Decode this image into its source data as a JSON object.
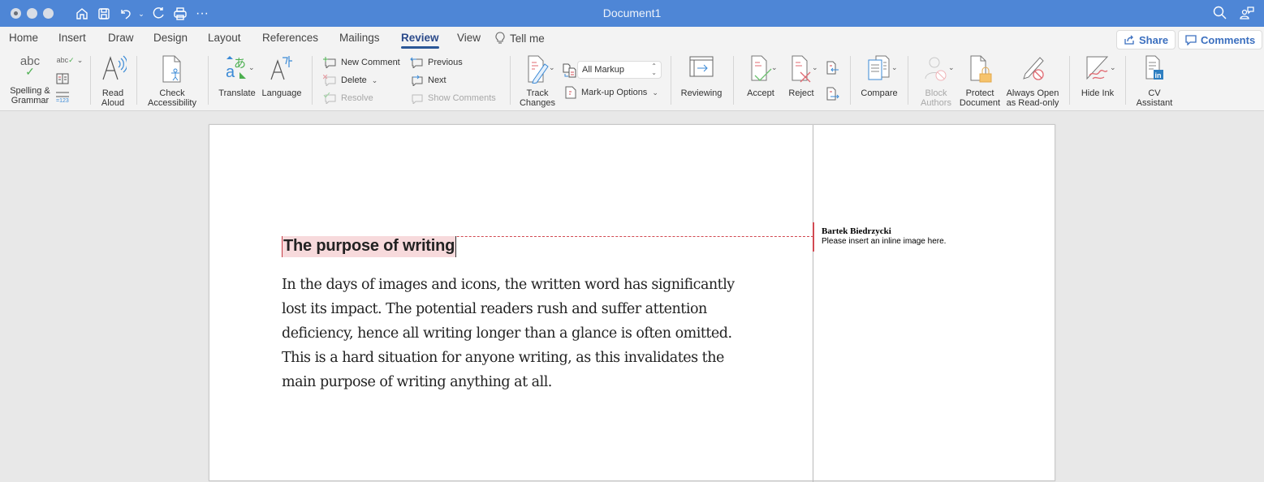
{
  "window": {
    "title": "Document1",
    "quick_access": [
      "home-icon",
      "save-icon",
      "undo-icon",
      "redo-icon",
      "print-icon",
      "more-icon"
    ]
  },
  "tabs": [
    {
      "label": "Home",
      "active": false
    },
    {
      "label": "Insert",
      "active": false
    },
    {
      "label": "Draw",
      "active": false
    },
    {
      "label": "Design",
      "active": false
    },
    {
      "label": "Layout",
      "active": false
    },
    {
      "label": "References",
      "active": false
    },
    {
      "label": "Mailings",
      "active": false
    },
    {
      "label": "Review",
      "active": true
    },
    {
      "label": "View",
      "active": false
    }
  ],
  "tell_me": "Tell me",
  "top_buttons": {
    "share": "Share",
    "comments": "Comments"
  },
  "ribbon": {
    "spelling": "Spelling &\nGrammar",
    "read_aloud": "Read\nAloud",
    "check_accessibility": "Check\nAccessibility",
    "translate": "Translate",
    "language": "Language",
    "new_comment": "New Comment",
    "delete": "Delete",
    "resolve": "Resolve",
    "previous": "Previous",
    "next": "Next",
    "show_comments": "Show Comments",
    "track_changes": "Track\nChanges",
    "markup_select": "All Markup",
    "markup_options": "Mark-up Options",
    "reviewing": "Reviewing",
    "accept": "Accept",
    "reject": "Reject",
    "compare": "Compare",
    "block_authors": "Block\nAuthors",
    "protect_document": "Protect\nDocument",
    "always_open_readonly": "Always Open\nas Read-only",
    "hide_ink": "Hide Ink",
    "cv_assistant": "CV\nAssistant"
  },
  "document": {
    "heading": "The purpose of writing",
    "body": "In the days of images and icons, the written word has significantly lost its impact. The potential readers rush and suffer attention deficiency, hence all writing longer than a glance is often omitted. This is a hard situation for anyone writing, as this invalidates the main purpose of writing anything at all.",
    "comment": {
      "author": "Bartek Biedrzycki",
      "text": "Please insert an inline image here."
    }
  },
  "colors": {
    "titlebar": "#4e86d6",
    "active_tab": "#2b5797",
    "comment_accent": "#d24a52",
    "heading_highlight": "#f7dadc"
  }
}
